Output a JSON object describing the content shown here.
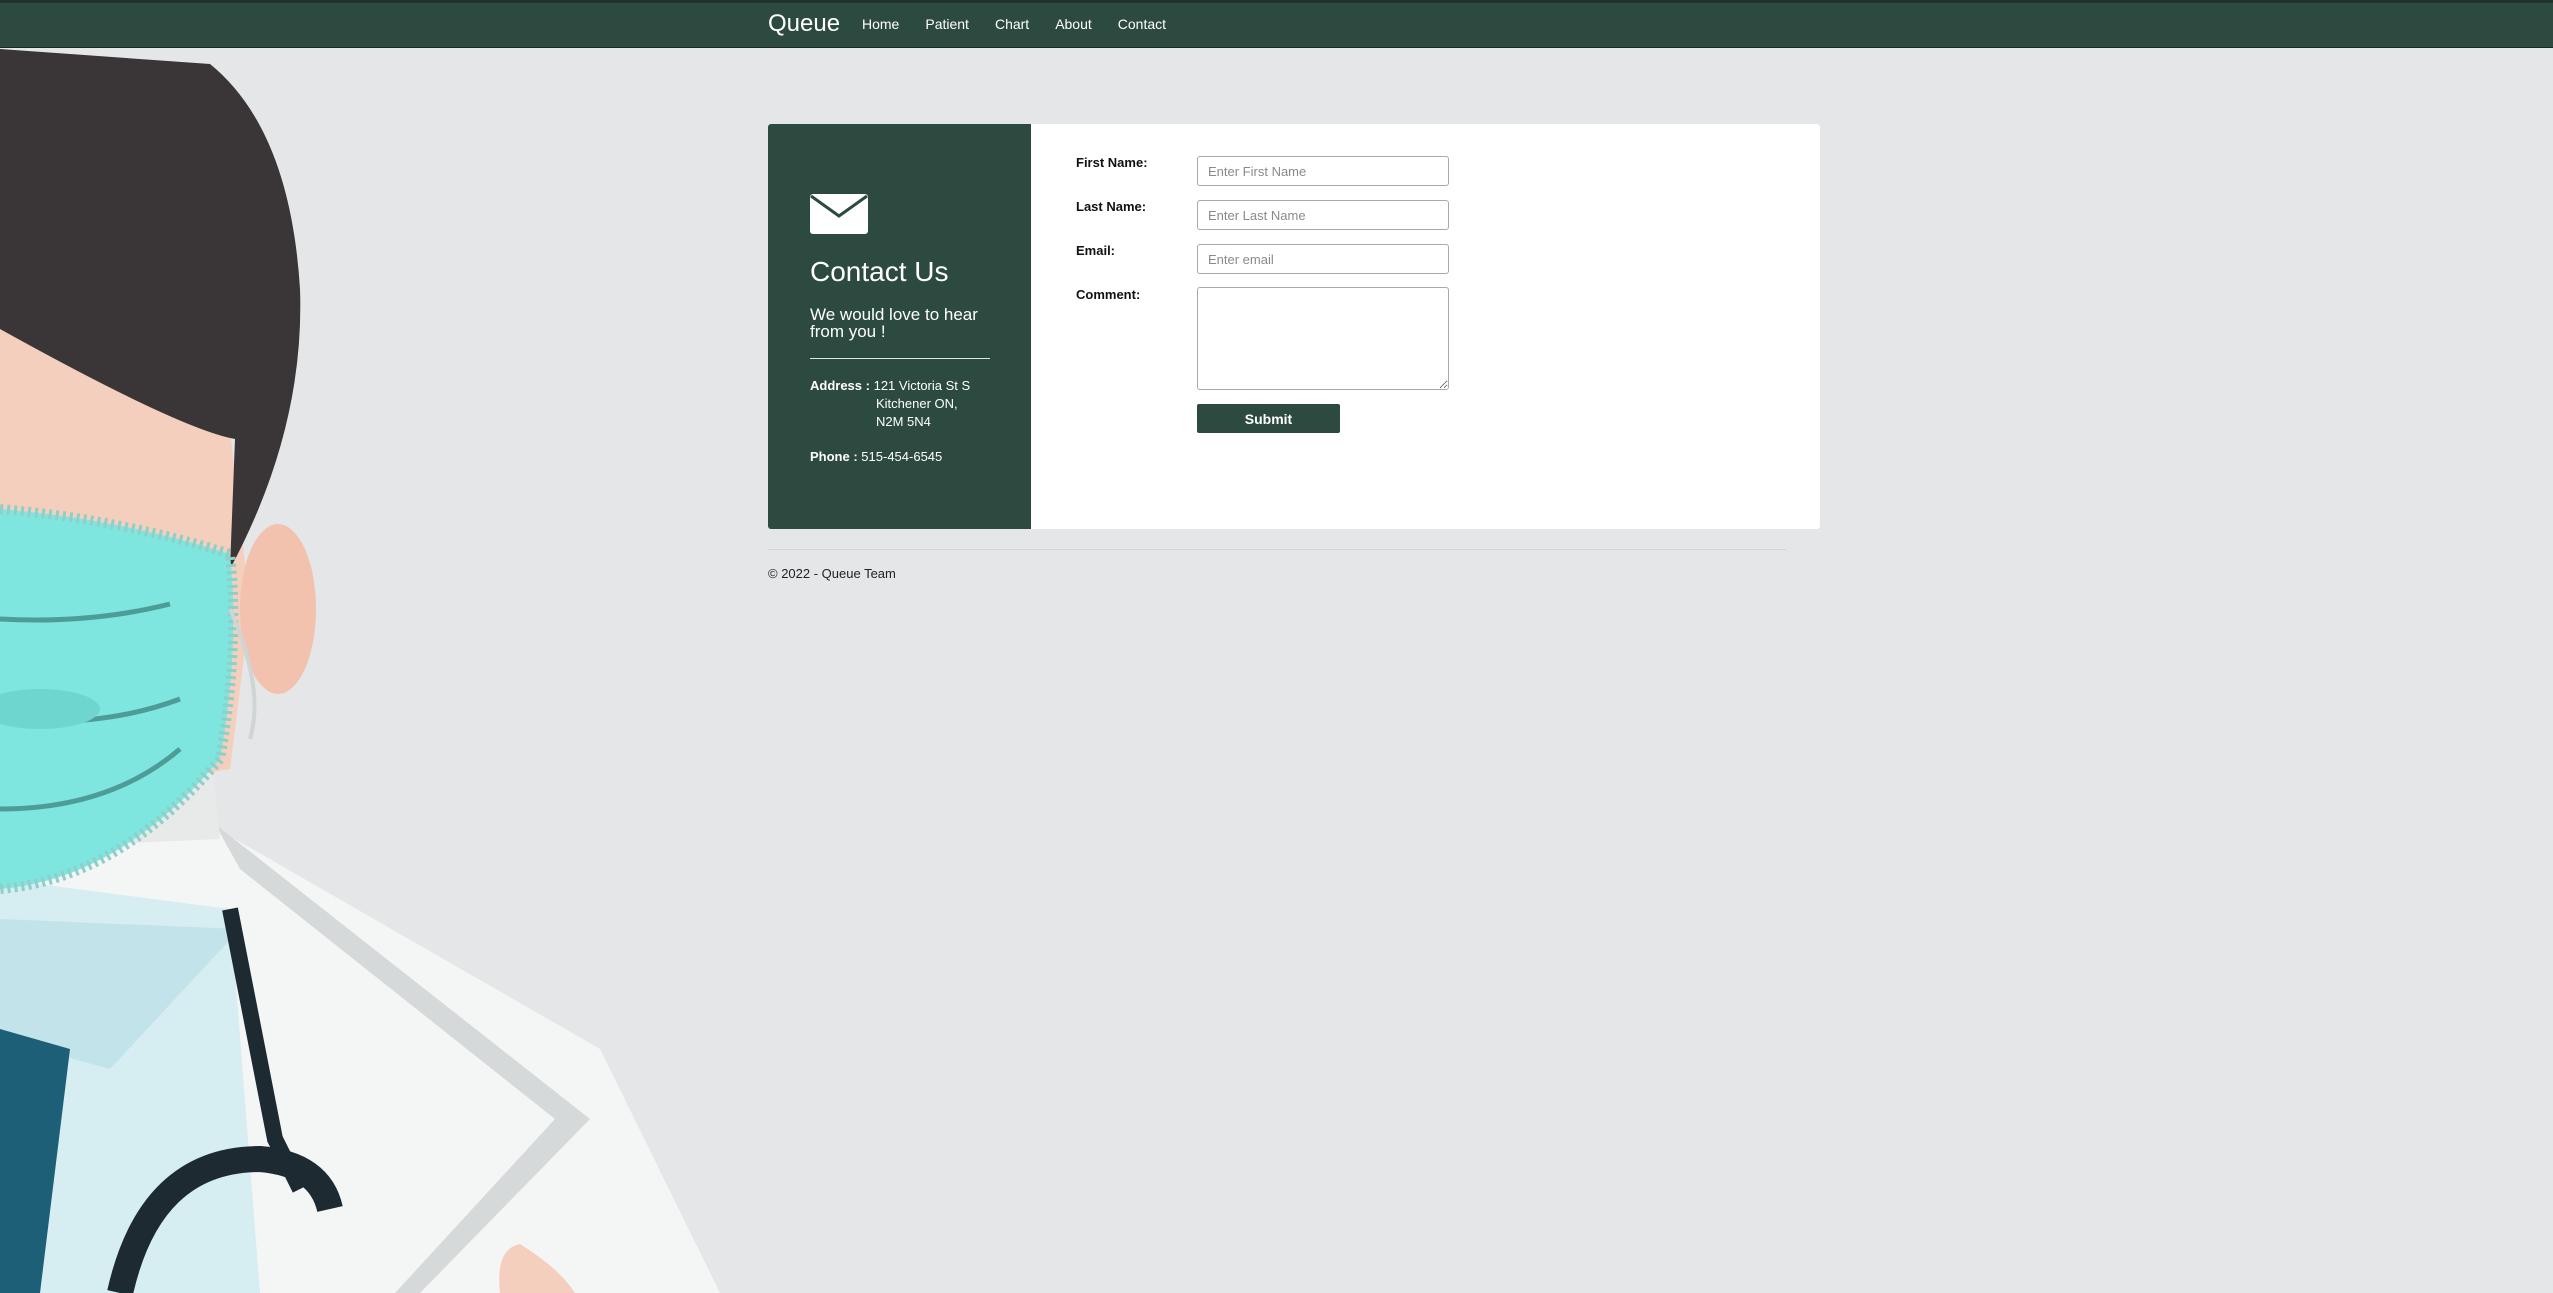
{
  "nav": {
    "brand": "Queue",
    "links": [
      "Home",
      "Patient",
      "Chart",
      "About",
      "Contact"
    ]
  },
  "contact_info": {
    "icon": "envelope-icon",
    "title": "Contact Us",
    "subtitle": "We would love to hear from you !",
    "address_label": "Address :",
    "address_line1": "121 Victoria St S",
    "address_line2": "Kitchener ON,",
    "address_line3": "N2M 5N4",
    "phone_label": "Phone :",
    "phone_value": "515-454-6545"
  },
  "form": {
    "first_name_label": "First Name:",
    "first_name_placeholder": "Enter First Name",
    "last_name_label": "Last Name:",
    "last_name_placeholder": "Enter Last Name",
    "email_label": "Email:",
    "email_placeholder": "Enter email",
    "comment_label": "Comment:",
    "submit_label": "Submit"
  },
  "footer": {
    "text": "© 2022 - Queue Team"
  },
  "colors": {
    "primary": "#2d4a40",
    "background": "#e5e6e8",
    "mask": "#7fe6df"
  }
}
